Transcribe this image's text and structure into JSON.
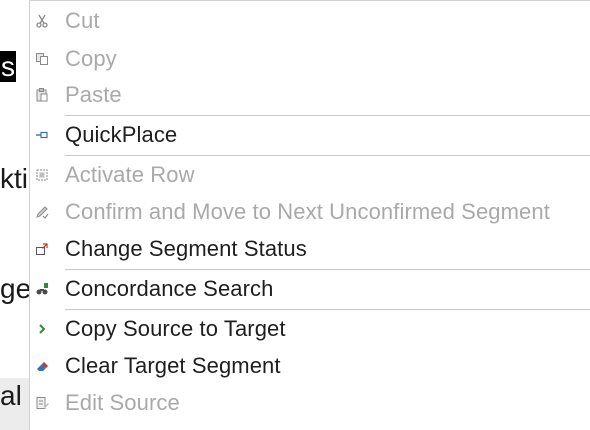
{
  "background": {
    "fragments": [
      "s",
      "kti",
      "ge",
      "al"
    ]
  },
  "context_menu": {
    "items": [
      {
        "label": "Cut",
        "icon": "scissors-icon",
        "enabled": false
      },
      {
        "label": "Copy",
        "icon": "copy-icon",
        "enabled": false
      },
      {
        "label": "Paste",
        "icon": "paste-icon",
        "enabled": false
      },
      {
        "label": "QuickPlace",
        "icon": "quickplace-icon",
        "enabled": true
      },
      {
        "label": "Activate Row",
        "icon": "activate-row-icon",
        "enabled": false
      },
      {
        "label": "Confirm and Move to Next Unconfirmed Segment",
        "icon": "pencil-icon",
        "enabled": false
      },
      {
        "label": "Change Segment Status",
        "icon": "segment-status-icon",
        "enabled": true
      },
      {
        "label": "Concordance Search",
        "icon": "binoculars-icon",
        "enabled": true
      },
      {
        "label": "Copy Source to Target",
        "icon": "chevron-right-icon",
        "enabled": true
      },
      {
        "label": "Clear Target Segment",
        "icon": "eraser-icon",
        "enabled": true
      },
      {
        "label": "Edit Source",
        "icon": "edit-source-icon",
        "enabled": false
      }
    ]
  },
  "colors": {
    "enabled_text": "#1e1e1e",
    "disabled_text": "#a9a9a9",
    "separator": "#c8c8c8",
    "accent_green": "#2e8b3a"
  }
}
